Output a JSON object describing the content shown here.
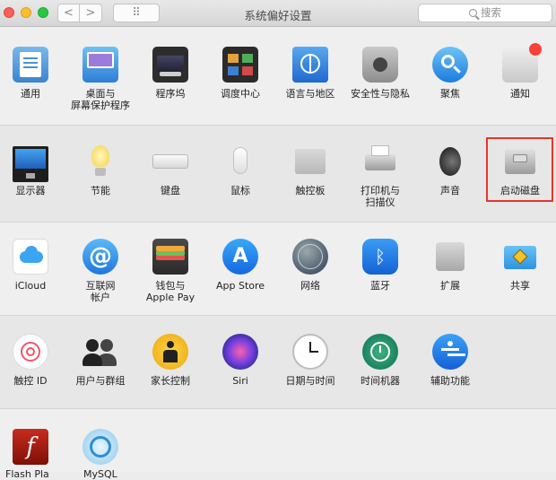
{
  "window": {
    "title": "系统偏好设置",
    "search_placeholder": "搜索",
    "nav_back": "<",
    "nav_forward": ">",
    "grid_glyph": "⠿"
  },
  "row1": [
    {
      "label": "通用",
      "icon": "general-icon"
    },
    {
      "label": "桌面与\n屏幕保护程序",
      "icon": "desktop-screensaver-icon"
    },
    {
      "label": "程序坞",
      "icon": "dock-icon"
    },
    {
      "label": "调度中心",
      "icon": "mission-control-icon"
    },
    {
      "label": "语言与地区",
      "icon": "language-region-icon"
    },
    {
      "label": "安全性与隐私",
      "icon": "security-privacy-icon"
    },
    {
      "label": "聚焦",
      "icon": "spotlight-icon"
    },
    {
      "label": "通知",
      "icon": "notifications-icon"
    }
  ],
  "row2": [
    {
      "label": "显示器",
      "icon": "displays-icon"
    },
    {
      "label": "节能",
      "icon": "energy-saver-icon"
    },
    {
      "label": "键盘",
      "icon": "keyboard-icon"
    },
    {
      "label": "鼠标",
      "icon": "mouse-icon"
    },
    {
      "label": "触控板",
      "icon": "trackpad-icon"
    },
    {
      "label": "打印机与\n扫描仪",
      "icon": "printers-scanners-icon"
    },
    {
      "label": "声音",
      "icon": "sound-icon"
    },
    {
      "label": "启动磁盘",
      "icon": "startup-disk-icon"
    }
  ],
  "row3": [
    {
      "label": "iCloud",
      "icon": "icloud-icon"
    },
    {
      "label": "互联网\n帐户",
      "icon": "internet-accounts-icon",
      "glyph": "@"
    },
    {
      "label": "钱包与\nApple Pay",
      "icon": "wallet-icon"
    },
    {
      "label": "App Store",
      "icon": "app-store-icon",
      "glyph": "A"
    },
    {
      "label": "网络",
      "icon": "network-icon"
    },
    {
      "label": "蓝牙",
      "icon": "bluetooth-icon",
      "glyph": "ᛒ"
    },
    {
      "label": "扩展",
      "icon": "extensions-icon"
    },
    {
      "label": "共享",
      "icon": "sharing-icon"
    }
  ],
  "row4": [
    {
      "label": "触控 ID",
      "icon": "touch-id-icon"
    },
    {
      "label": "用户与群组",
      "icon": "users-groups-icon"
    },
    {
      "label": "家长控制",
      "icon": "parental-controls-icon"
    },
    {
      "label": "Siri",
      "icon": "siri-icon"
    },
    {
      "label": "日期与时间",
      "icon": "date-time-icon"
    },
    {
      "label": "时间机器",
      "icon": "time-machine-icon"
    },
    {
      "label": "辅助功能",
      "icon": "accessibility-icon"
    }
  ],
  "row5": [
    {
      "label": "Flash Pla",
      "icon": "flash-player-icon",
      "glyph": "f"
    },
    {
      "label": "MySQL",
      "icon": "mysql-icon"
    }
  ],
  "highlight_color": "#e3372b"
}
